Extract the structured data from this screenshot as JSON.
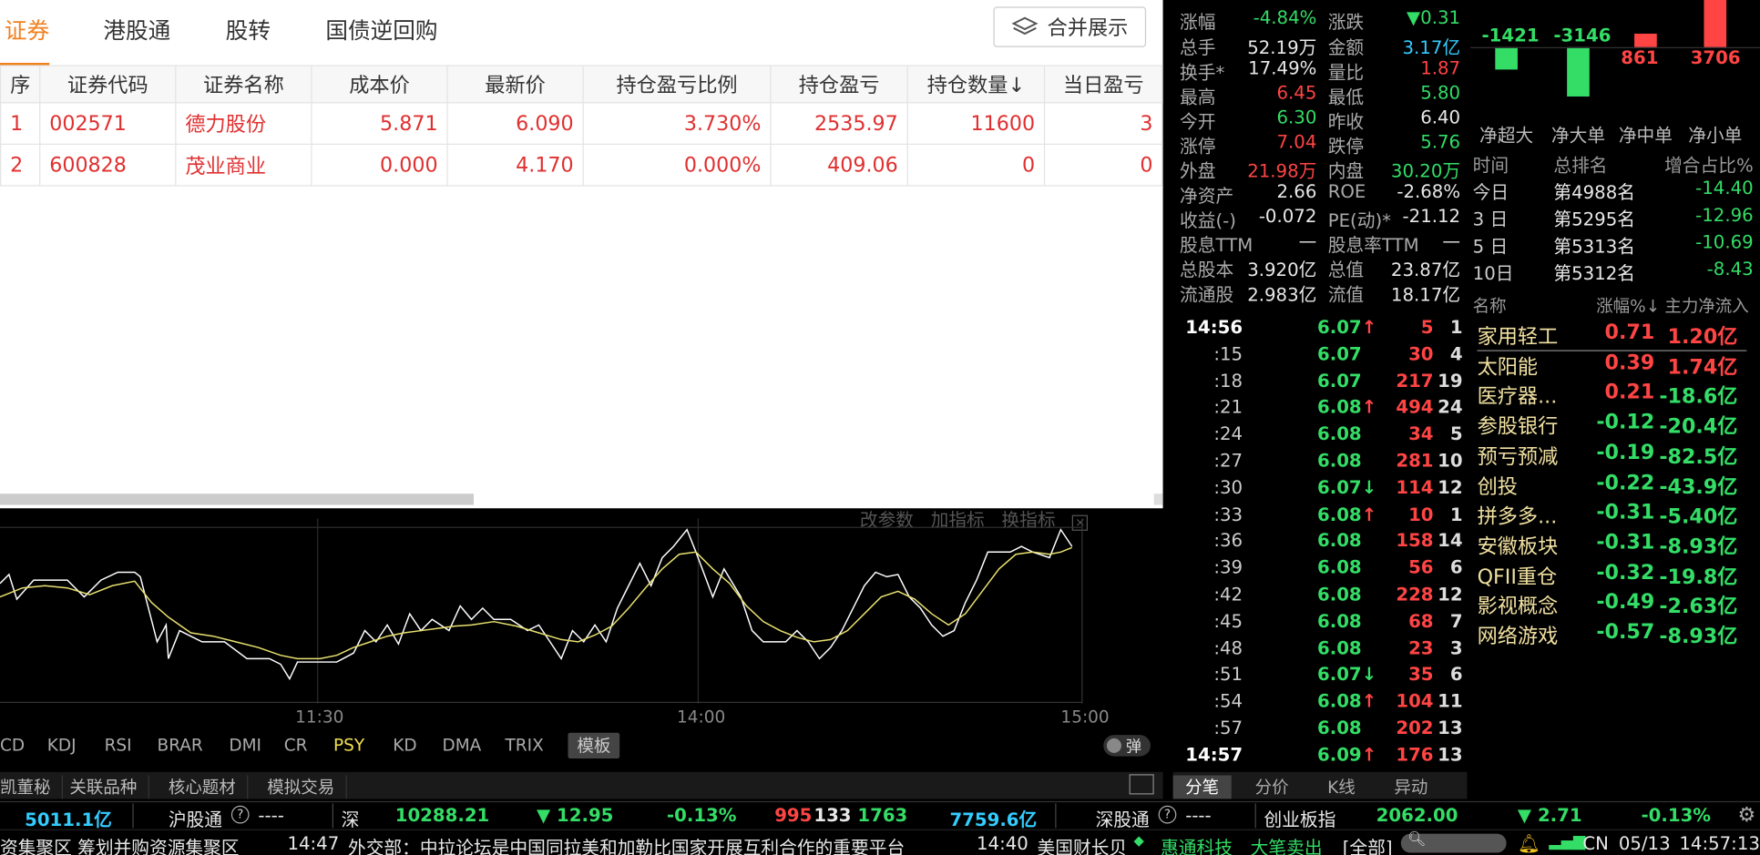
{
  "portfolio": {
    "tabs": [
      "证券",
      "港股通",
      "股转",
      "国债逆回购"
    ],
    "merge_label": "合并展示",
    "columns": [
      "序",
      "证券代码",
      "证券名称",
      "成本价",
      "最新价",
      "持仓盈亏比例",
      "持仓盈亏",
      "持仓数量↓",
      "当日盈亏"
    ],
    "rows": [
      [
        "1",
        "002571",
        "德力股份",
        "5.871",
        "6.090",
        "3.730%",
        "2535.97",
        "11600",
        "3"
      ],
      [
        "2",
        "600828",
        "茂业商业",
        "0.000",
        "4.170",
        "0.000%",
        "409.06",
        "0",
        "0"
      ]
    ]
  },
  "indicator": {
    "options": [
      "改参数",
      "加指标",
      "换指标"
    ],
    "close": "×",
    "times": [
      "11:30",
      "14:00",
      "15:00"
    ],
    "tabs": [
      "CD",
      "KDJ",
      "RSI",
      "BRAR",
      "DMI",
      "CR",
      "PSY",
      "KD",
      "DMA",
      "TRIX"
    ],
    "active_tab": "PSY",
    "template": "模板",
    "popup": "弹",
    "bottom_tabs": [
      "凯董秘",
      "关联品种",
      "核心题材",
      "模拟交易"
    ]
  },
  "quote": {
    "rows": [
      {
        "l1": "涨幅",
        "v1": "-4.84%",
        "c1": "grn",
        "l2": "涨跌",
        "v2": "▼0.31",
        "c2": "grn"
      },
      {
        "l1": "总手",
        "v1": "52.19万",
        "c1": "wht",
        "l2": "金额",
        "v2": "3.17亿",
        "c2": "cyn"
      },
      {
        "l1": "换手*",
        "v1": "17.49%",
        "c1": "wht",
        "l2": "量比",
        "v2": "1.87",
        "c2": "red"
      },
      {
        "l1": "最高",
        "v1": "6.45",
        "c1": "red",
        "l2": "最低",
        "v2": "5.80",
        "c2": "grn"
      },
      {
        "l1": "今开",
        "v1": "6.30",
        "c1": "grn",
        "l2": "昨收",
        "v2": "6.40",
        "c2": "wht"
      },
      {
        "l1": "涨停",
        "v1": "7.04",
        "c1": "red",
        "l2": "跌停",
        "v2": "5.76",
        "c2": "grn"
      },
      {
        "l1": "外盘",
        "v1": "21.98万",
        "c1": "red",
        "l2": "内盘",
        "v2": "30.20万",
        "c2": "grn"
      },
      {
        "l1": "净资产",
        "v1": "2.66",
        "c1": "wht",
        "l2": "ROE",
        "v2": "-2.68%",
        "c2": "wht"
      },
      {
        "l1": "收益(-)",
        "v1": "-0.072",
        "c1": "wht",
        "l2": "PE(动)*",
        "v2": "-21.12",
        "c2": "wht"
      },
      {
        "l1": "股息TTM",
        "v1": "—",
        "c1": "wht",
        "l2": "股息率TTM",
        "v2": "—",
        "c2": "wht"
      },
      {
        "l1": "总股本",
        "v1": "3.920亿",
        "c1": "wht",
        "l2": "总值",
        "v2": "23.87亿",
        "c2": "wht"
      },
      {
        "l1": "流通股",
        "v1": "2.983亿",
        "c1": "wht",
        "l2": "流值",
        "v2": "18.17亿",
        "c2": "wht"
      }
    ]
  },
  "ticks": {
    "rows": [
      {
        "t": "14:56",
        "p": "6.07",
        "a": "↑",
        "ac": "red",
        "v": "5",
        "n": "1"
      },
      {
        "t": ":15",
        "p": "6.07",
        "a": "",
        "ac": "",
        "v": "30",
        "n": "4"
      },
      {
        "t": ":18",
        "p": "6.07",
        "a": "",
        "ac": "",
        "v": "217",
        "n": "19"
      },
      {
        "t": ":21",
        "p": "6.08",
        "a": "↑",
        "ac": "red",
        "v": "494",
        "n": "24"
      },
      {
        "t": ":24",
        "p": "6.08",
        "a": "",
        "ac": "",
        "v": "34",
        "n": "5"
      },
      {
        "t": ":27",
        "p": "6.08",
        "a": "",
        "ac": "",
        "v": "281",
        "n": "10"
      },
      {
        "t": ":30",
        "p": "6.07",
        "a": "↓",
        "ac": "grn",
        "v": "114",
        "n": "12"
      },
      {
        "t": ":33",
        "p": "6.08",
        "a": "↑",
        "ac": "red",
        "v": "10",
        "n": "1"
      },
      {
        "t": ":36",
        "p": "6.08",
        "a": "",
        "ac": "",
        "v": "158",
        "n": "14"
      },
      {
        "t": ":39",
        "p": "6.08",
        "a": "",
        "ac": "",
        "v": "56",
        "n": "6"
      },
      {
        "t": ":42",
        "p": "6.08",
        "a": "",
        "ac": "",
        "v": "228",
        "n": "12"
      },
      {
        "t": ":45",
        "p": "6.08",
        "a": "",
        "ac": "",
        "v": "68",
        "n": "7"
      },
      {
        "t": ":48",
        "p": "6.08",
        "a": "",
        "ac": "",
        "v": "23",
        "n": "3"
      },
      {
        "t": ":51",
        "p": "6.07",
        "a": "↓",
        "ac": "grn",
        "v": "35",
        "n": "6"
      },
      {
        "t": ":54",
        "p": "6.08",
        "a": "↑",
        "ac": "red",
        "v": "104",
        "n": "11"
      },
      {
        "t": ":57",
        "p": "6.08",
        "a": "",
        "ac": "",
        "v": "202",
        "n": "13"
      },
      {
        "t": "14:57",
        "p": "6.09",
        "a": "↑",
        "ac": "red",
        "v": "176",
        "n": "13"
      }
    ],
    "tabs": [
      "分笔",
      "分价",
      "K线",
      "异动"
    ]
  },
  "flow": {
    "values": [
      -1421,
      -3146,
      861,
      3706
    ],
    "labels": [
      "-1421",
      "-3146",
      "861",
      "3706"
    ],
    "cats": [
      "净超大",
      "净大单",
      "净中单",
      "净小单"
    ]
  },
  "rank": {
    "header": [
      "时间",
      "总排名",
      "增合占比%"
    ],
    "rows": [
      {
        "t": "今日",
        "r": "第4988名",
        "v": "-14.40"
      },
      {
        "t": "3 日",
        "r": "第5295名",
        "v": "-12.96"
      },
      {
        "t": "5 日",
        "r": "第5313名",
        "v": "-10.69"
      },
      {
        "t": "10日",
        "r": "第5312名",
        "v": "-8.43"
      }
    ]
  },
  "sectors": {
    "header": [
      "名称",
      "涨幅%↓",
      "主力净流入"
    ],
    "rows": [
      {
        "n": "家用轻工",
        "p": "0.71",
        "pc": "red",
        "f": "1.20亿",
        "fc": "red"
      },
      {
        "n": "太阳能",
        "p": "0.39",
        "pc": "red",
        "f": "1.74亿",
        "fc": "red"
      },
      {
        "n": "医疗器...",
        "p": "0.21",
        "pc": "red",
        "f": "-18.6亿",
        "fc": "grn"
      },
      {
        "n": "参股银行",
        "p": "-0.12",
        "pc": "grn",
        "f": "-20.4亿",
        "fc": "grn"
      },
      {
        "n": "预亏预减",
        "p": "-0.19",
        "pc": "grn",
        "f": "-82.5亿",
        "fc": "grn"
      },
      {
        "n": "创投",
        "p": "-0.22",
        "pc": "grn",
        "f": "-43.9亿",
        "fc": "grn"
      },
      {
        "n": "拼多多...",
        "p": "-0.31",
        "pc": "grn",
        "f": "-5.40亿",
        "fc": "grn"
      },
      {
        "n": "安徽板块",
        "p": "-0.31",
        "pc": "grn",
        "f": "-8.93亿",
        "fc": "grn"
      },
      {
        "n": "QFII重仓",
        "p": "-0.32",
        "pc": "grn",
        "f": "-19.8亿",
        "fc": "grn"
      },
      {
        "n": "影视概念",
        "p": "-0.49",
        "pc": "grn",
        "f": "-2.63亿",
        "fc": "grn"
      },
      {
        "n": "网络游戏",
        "p": "-0.57",
        "pc": "grn",
        "f": "-8.93亿",
        "fc": "grn"
      }
    ]
  },
  "ticker": {
    "amt1": "5011.1亿",
    "sh_connect": "沪股通",
    "sh_connect_val": "----",
    "sz_label": "深",
    "sz_index": "10288.21",
    "sz_change": "▼ 12.95",
    "sz_pct": "-0.13%",
    "sz_up": "995",
    "sz_flat": "133",
    "sz_down": "1763",
    "sz_amt": "7759.6亿",
    "sz_connect": "深股通",
    "sz_connect_val": "----",
    "cyb_label": "创业板指",
    "cyb_index": "2062.00",
    "cyb_change": "▼ 2.71",
    "cyb_pct": "-0.13%"
  },
  "news": {
    "item1": "资集聚区 筹划并购资源集聚区",
    "time2": "14:47",
    "item2": "外交部：中拉论坛是中国同拉美和加勒比国家开展互利合作的重要平台",
    "time3": "14:40",
    "item3": "美国财长贝",
    "alert_stock": "惠通科技",
    "alert_text": "大笔卖出",
    "filter": "[全部]",
    "lang": "CN",
    "date": "05/13",
    "time": "14:57:13"
  },
  "colors": {
    "up": "#ff4444",
    "down": "#33dd66",
    "accent": "#f08020",
    "bg": "#000000"
  }
}
